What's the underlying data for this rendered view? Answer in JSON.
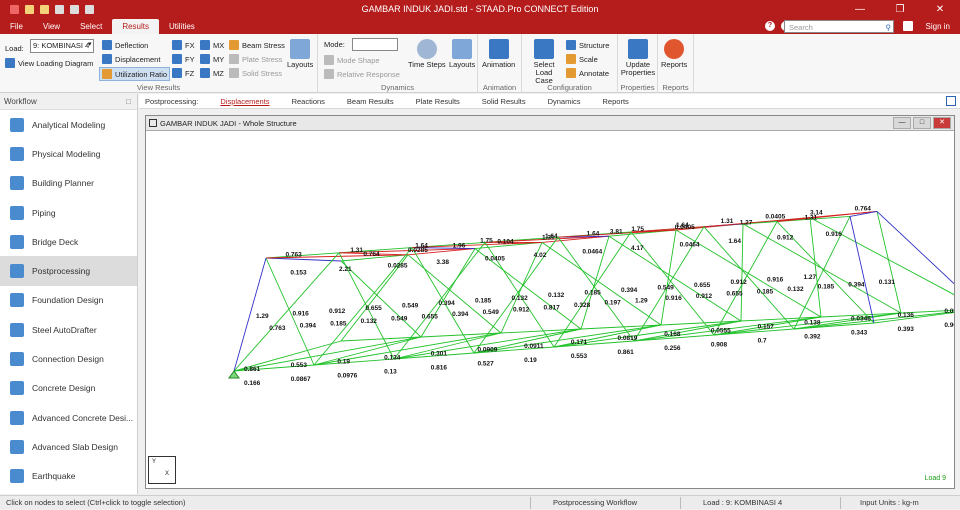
{
  "window": {
    "title": "GAMBAR INDUK JADI.std - STAAD.Pro CONNECT Edition",
    "sign_in": "Sign in",
    "search_placeholder": "Search"
  },
  "menu": [
    "File",
    "View",
    "Select",
    "Results",
    "Utilities"
  ],
  "ribbon": {
    "load_label": "Load:",
    "load_value": "9: KOMBINASI 4",
    "view_loading_diagram": "View Loading Diagram",
    "deflection": "Deflection",
    "displacement": "Displacement",
    "utilization_ratio": "Utilization Ratio",
    "fx": "FX",
    "fy": "FY",
    "fz": "FZ",
    "mx": "MX",
    "my": "MY",
    "mz": "MZ",
    "beam_stress": "Beam Stress",
    "plate_stress": "Plate Stress",
    "solid_stress": "Solid Stress",
    "layouts": "Layouts",
    "view_results_group": "View Results",
    "mode_label": "Mode:",
    "mode_shape": "Mode Shape",
    "relative_response": "Relative Response",
    "time_steps": "Time Steps",
    "layouts2": "Layouts",
    "dynamics_group": "Dynamics",
    "animation": "Animation",
    "animation_group": "Animation",
    "select_load_case": "Select Load Case",
    "structure": "Structure",
    "scale": "Scale",
    "annotate": "Annotate",
    "configuration_group": "Configuration",
    "update_properties": "Update Properties",
    "properties_group": "Properties",
    "reports": "Reports",
    "reports_group": "Reports"
  },
  "workflow": {
    "header": "Workflow",
    "items": [
      "Analytical Modeling",
      "Physical Modeling",
      "Building Planner",
      "Piping",
      "Bridge Deck",
      "Postprocessing",
      "Foundation Design",
      "Steel AutoDrafter",
      "Connection Design",
      "Concrete Design",
      "Advanced Concrete Desi...",
      "Advanced Slab Design",
      "Earthquake"
    ],
    "active_index": 5
  },
  "subtabs": {
    "prefix": "Postprocessing:",
    "tabs": [
      "Displacements",
      "Reactions",
      "Beam Results",
      "Plate Results",
      "Solid Results",
      "Dynamics",
      "Reports"
    ],
    "active": "Displacements"
  },
  "viewport": {
    "title": "GAMBAR INDUK JADI - Whole Structure",
    "load_badge": "Load 9",
    "labels": {
      "top_chord": [
        "0.764",
        "0.0285",
        "1.96",
        "0.104",
        "1.31",
        "1.64",
        "1.75",
        "1.64",
        "1.31",
        "0.0405",
        "3.14",
        "0.764"
      ],
      "upper": [
        "0.763",
        "1.31",
        "1.64",
        "1.75",
        "1.64",
        "3.81",
        "0.0405",
        "1.27",
        "1.31"
      ],
      "mid": [
        "0.153",
        "2.21",
        "0.0285",
        "3.38",
        "0.0405",
        "4.02",
        "0.0464",
        "4.17",
        "0.0464",
        "1.64",
        "0.912",
        "0.916"
      ],
      "diag": [
        "1.29",
        "0.916",
        "0.912",
        "0.655",
        "0.549",
        "0.394",
        "0.185",
        "0.132",
        "0.132",
        "0.185",
        "0.394",
        "0.549",
        "0.655",
        "0.912",
        "0.916",
        "1.27"
      ],
      "low": [
        "0.763",
        "0.394",
        "0.185",
        "0.132",
        "0.549",
        "0.655",
        "0.394",
        "0.549",
        "0.912",
        "0.817",
        "0.328",
        "0.197",
        "1.29",
        "0.916",
        "0.912",
        "0.655",
        "0.185",
        "0.132",
        "0.185",
        "0.394",
        "0.131"
      ],
      "bottom": [
        "0.861",
        "0.553",
        "0.19",
        "0.134",
        "0.301",
        "0.0909",
        "0.0911",
        "0.171",
        "0.0819",
        "0.168",
        "0.0555",
        "0.157",
        "0.138",
        "0.0346",
        "0.136",
        "0.0577",
        "0.166",
        "0.0867",
        "0.0976",
        "0.13",
        "0.816",
        "0.527",
        "0.19",
        "0.553",
        "0.861",
        "0.256",
        "0.908",
        "0.7",
        "0.392",
        "0.343",
        "0.393",
        "0.903"
      ]
    }
  },
  "status": {
    "hint": "Click on nodes to select (Ctrl+click to toggle selection)",
    "workflow": "Postprocessing Workflow",
    "load": "Load : 9: KOMBINASI 4",
    "units": "Input Units : kg-m"
  }
}
